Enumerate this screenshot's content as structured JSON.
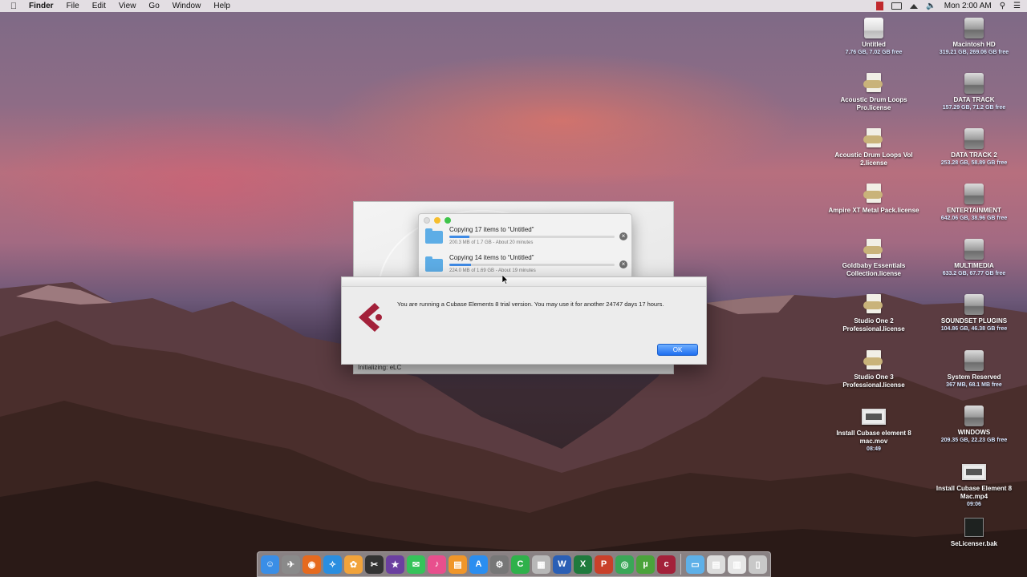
{
  "menubar": {
    "app_name": "Finder",
    "items": [
      "File",
      "Edit",
      "View",
      "Go",
      "Window",
      "Help"
    ],
    "clock": "Mon 2:00 AM",
    "status_icons": [
      "cubase-flag-icon",
      "display-mirroring-icon",
      "eject-icon",
      "volume-icon",
      "search-icon",
      "list-icon"
    ]
  },
  "desktop_icons": [
    {
      "name": "Untitled",
      "sub": "7.76 GB, 7.02 GB free",
      "icon": "external-drive-icon"
    },
    {
      "name": "Macintosh HD",
      "sub": "319.21 GB, 269.06 GB free",
      "icon": "hard-drive-icon"
    },
    {
      "name": "Acoustic Drum Loops Pro.license",
      "sub": "",
      "icon": "license-file-icon"
    },
    {
      "name": "DATA TRACK",
      "sub": "157.29 GB, 71.2 GB free",
      "icon": "hard-drive-icon"
    },
    {
      "name": "Acoustic Drum Loops Vol 2.license",
      "sub": "",
      "icon": "license-file-icon"
    },
    {
      "name": "DATA TRACK 2",
      "sub": "253.28 GB, 58.89 GB free",
      "icon": "hard-drive-icon"
    },
    {
      "name": "Ampire XT Metal Pack.license",
      "sub": "",
      "icon": "license-file-icon"
    },
    {
      "name": "ENTERTAINMENT",
      "sub": "642.06 GB, 38.96 GB free",
      "icon": "hard-drive-icon"
    },
    {
      "name": "Goldbaby Essentials Collection.license",
      "sub": "",
      "icon": "license-file-icon"
    },
    {
      "name": "MULTIMEDIA",
      "sub": "633.2 GB, 67.77 GB free",
      "icon": "hard-drive-icon"
    },
    {
      "name": "Studio One 2 Professional.license",
      "sub": "",
      "icon": "license-file-icon"
    },
    {
      "name": "SOUNDSET PLUGINS",
      "sub": "104.86 GB, 46.38 GB free",
      "icon": "hard-drive-icon"
    },
    {
      "name": "Studio One 3 Professional.license",
      "sub": "",
      "icon": "license-file-icon"
    },
    {
      "name": "System Reserved",
      "sub": "367 MB, 68.1 MB free",
      "icon": "hard-drive-icon"
    },
    {
      "name": "Install Cubase element 8 mac.mov",
      "sub": "08:49",
      "icon": "movie-file-icon"
    },
    {
      "name": "WINDOWS",
      "sub": "209.35 GB, 22.23 GB free",
      "icon": "hard-drive-icon"
    },
    {
      "name": "Install Cubase Element 8 Mac.mp4",
      "sub": "09:06",
      "icon": "movie-file-icon"
    },
    {
      "name": "SeLicenser.bak",
      "sub": "",
      "icon": "bak-file-icon"
    }
  ],
  "splash": {
    "status": "Initializing: eLC"
  },
  "copy_window": {
    "jobs": [
      {
        "title": "Copying 17 items to “Untitled”",
        "detail": "200.3 MB of 1.7 GB - About 20 minutes",
        "progress": 0.12
      },
      {
        "title": "Copying 14 items to “Untitled”",
        "detail": "224.0 MB of 1.69 GB - About 19 minutes",
        "progress": 0.13
      }
    ]
  },
  "dialog": {
    "message": "You are running a Cubase Elements 8 trial version. You may use it for another 24747 days 17 hours.",
    "ok_label": "OK"
  },
  "dock": {
    "items": [
      {
        "name": "finder-icon",
        "color": "#3a8ee6",
        "glyph": "☺"
      },
      {
        "name": "launchpad-icon",
        "color": "#8a8a8a",
        "glyph": "✈"
      },
      {
        "name": "firefox-icon",
        "color": "#e66a1f",
        "glyph": "◉"
      },
      {
        "name": "safari-icon",
        "color": "#2a8ee0",
        "glyph": "✧"
      },
      {
        "name": "photos-icon",
        "color": "#f1a33b",
        "glyph": "✿"
      },
      {
        "name": "final-cut-icon",
        "color": "#333333",
        "glyph": "✂"
      },
      {
        "name": "imovie-icon",
        "color": "#6b3fa0",
        "glyph": "★"
      },
      {
        "name": "messages-icon",
        "color": "#35c35a",
        "glyph": "✉"
      },
      {
        "name": "itunes-icon",
        "color": "#e84f8d",
        "glyph": "♪"
      },
      {
        "name": "ibooks-icon",
        "color": "#f0962a",
        "glyph": "▤"
      },
      {
        "name": "app-store-icon",
        "color": "#2b8ef0",
        "glyph": "A"
      },
      {
        "name": "system-preferences-icon",
        "color": "#777777",
        "glyph": "⚙"
      },
      {
        "name": "facetime-icon",
        "color": "#2fb14b",
        "glyph": "C"
      },
      {
        "name": "numbers-icon",
        "color": "#b8b8b8",
        "glyph": "▦"
      },
      {
        "name": "word-icon",
        "color": "#2b5fb5",
        "glyph": "W"
      },
      {
        "name": "excel-icon",
        "color": "#1f7a3d",
        "glyph": "X"
      },
      {
        "name": "powerpoint-icon",
        "color": "#c9402a",
        "glyph": "P"
      },
      {
        "name": "chrome-icon",
        "color": "#3aa757",
        "glyph": "◎"
      },
      {
        "name": "utorrent-icon",
        "color": "#4aa33b",
        "glyph": "µ"
      },
      {
        "name": "cubase-icon",
        "color": "#a3213a",
        "glyph": "c"
      }
    ],
    "right_items": [
      {
        "name": "downloads-folder-icon",
        "color": "#5eb0e8",
        "glyph": "▭"
      },
      {
        "name": "document-stack-icon",
        "color": "#dcdcdc",
        "glyph": "▤"
      },
      {
        "name": "document-stack-2-icon",
        "color": "#e6e6e6",
        "glyph": "▥"
      },
      {
        "name": "trash-icon",
        "color": "#c8c8c8",
        "glyph": "▯"
      }
    ]
  }
}
